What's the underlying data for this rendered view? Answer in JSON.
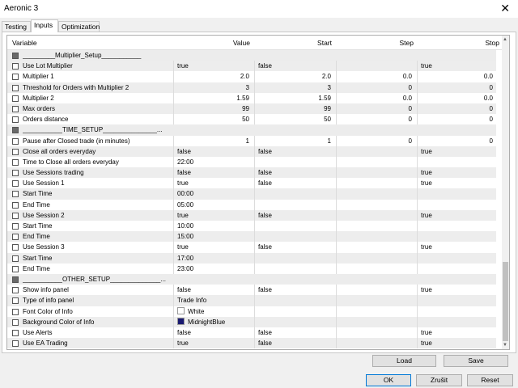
{
  "window": {
    "title": "Aeronic 3",
    "close_glyph": "✕"
  },
  "tabs": [
    {
      "label": "Testing"
    },
    {
      "label": "Inputs"
    },
    {
      "label": "Optimization"
    }
  ],
  "grid": {
    "headers": {
      "variable": "Variable",
      "value": "Value",
      "start": "Start",
      "step": "Step",
      "stop": "Stop"
    },
    "rows": [
      {
        "type": "separator",
        "name": "_________Multiplier_Setup___________",
        "value": "",
        "start": "",
        "step": "",
        "stop": ""
      },
      {
        "type": "bool",
        "name": "Use Lot Multiplier",
        "value": "true",
        "start": "false",
        "step": "",
        "stop": "true"
      },
      {
        "type": "num",
        "name": "Multiplier 1",
        "value": "2.0",
        "start": "2.0",
        "step": "0.0",
        "stop": "0.0"
      },
      {
        "type": "num",
        "name": "Threshold for Orders with Multiplier 2",
        "value": "3",
        "start": "3",
        "step": "0",
        "stop": "0"
      },
      {
        "type": "num",
        "name": "Multiplier 2",
        "value": "1.59",
        "start": "1.59",
        "step": "0.0",
        "stop": "0.0"
      },
      {
        "type": "num",
        "name": "Max orders",
        "value": "99",
        "start": "99",
        "step": "0",
        "stop": "0"
      },
      {
        "type": "num",
        "name": "Orders distance",
        "value": "50",
        "start": "50",
        "step": "0",
        "stop": "0"
      },
      {
        "type": "separator",
        "name": "___________TIME_SETUP_______________...",
        "value": "",
        "start": "",
        "step": "",
        "stop": ""
      },
      {
        "type": "num",
        "name": "Pause after Closed trade (in minutes)",
        "value": "1",
        "start": "1",
        "step": "0",
        "stop": "0"
      },
      {
        "type": "bool",
        "name": "Close all orders everyday",
        "value": "false",
        "start": "false",
        "step": "",
        "stop": "true"
      },
      {
        "type": "text",
        "name": "Time to Close all orders everyday",
        "value": "22:00",
        "start": "",
        "step": "",
        "stop": ""
      },
      {
        "type": "bool",
        "name": "Use Sessions trading",
        "value": "false",
        "start": "false",
        "step": "",
        "stop": "true"
      },
      {
        "type": "bool",
        "name": "Use Session 1",
        "value": "true",
        "start": "false",
        "step": "",
        "stop": "true"
      },
      {
        "type": "text",
        "name": "Start Time",
        "value": "00:00",
        "start": "",
        "step": "",
        "stop": ""
      },
      {
        "type": "text",
        "name": "End Time",
        "value": "05:00",
        "start": "",
        "step": "",
        "stop": ""
      },
      {
        "type": "bool",
        "name": "Use Session 2",
        "value": "true",
        "start": "false",
        "step": "",
        "stop": "true"
      },
      {
        "type": "text",
        "name": "Start Time",
        "value": "10:00",
        "start": "",
        "step": "",
        "stop": ""
      },
      {
        "type": "text",
        "name": "End Time",
        "value": "15:00",
        "start": "",
        "step": "",
        "stop": ""
      },
      {
        "type": "bool",
        "name": "Use Session 3",
        "value": "true",
        "start": "false",
        "step": "",
        "stop": "true"
      },
      {
        "type": "text",
        "name": "Start Time",
        "value": "17:00",
        "start": "",
        "step": "",
        "stop": ""
      },
      {
        "type": "text",
        "name": "End Time",
        "value": "23:00",
        "start": "",
        "step": "",
        "stop": ""
      },
      {
        "type": "separator",
        "name": "___________OTHER_SETUP______________...",
        "value": "",
        "start": "",
        "step": "",
        "stop": ""
      },
      {
        "type": "bool",
        "name": "Show info panel",
        "value": "false",
        "start": "false",
        "step": "",
        "stop": "true"
      },
      {
        "type": "text",
        "name": "Type of info panel",
        "value": "Trade Info",
        "start": "",
        "step": "",
        "stop": ""
      },
      {
        "type": "color",
        "name": "Font Color of Info",
        "value": "White",
        "swatch": "#ffffff",
        "start": "",
        "step": "",
        "stop": ""
      },
      {
        "type": "color",
        "name": "Background Color of Info",
        "value": "MidnightBlue",
        "swatch": "#191970",
        "start": "",
        "step": "",
        "stop": ""
      },
      {
        "type": "bool",
        "name": "Use Alerts",
        "value": "false",
        "start": "false",
        "step": "",
        "stop": "true"
      },
      {
        "type": "bool",
        "name": "Use EA Trading",
        "value": "true",
        "start": "false",
        "step": "",
        "stop": "true"
      }
    ]
  },
  "buttons": {
    "load": "Load",
    "save": "Save",
    "ok": "OK",
    "cancel": "Zrušit",
    "reset": "Reset"
  },
  "icons": {
    "checkbox": "checkbox-icon",
    "separator": "section-flag-icon",
    "scroll_up": "▲",
    "scroll_down": "▼"
  }
}
